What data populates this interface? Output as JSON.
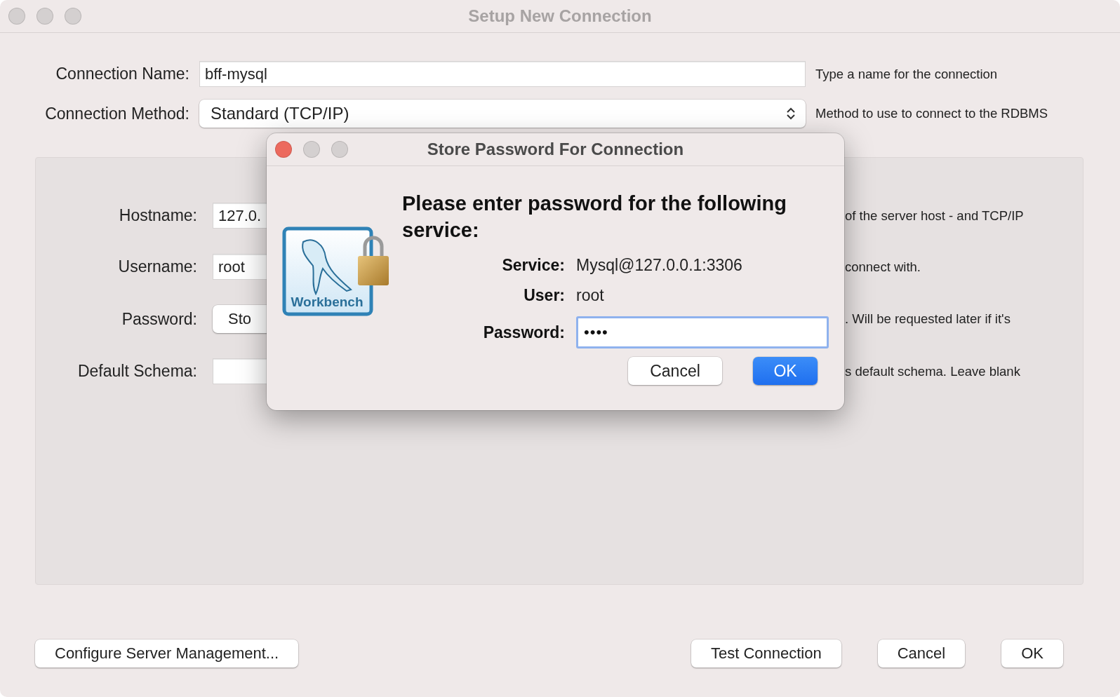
{
  "window": {
    "title": "Setup New Connection"
  },
  "form": [
    {
      "label": "Connection Name:",
      "kind": "text",
      "value": "bff-mysql",
      "help": "Type a name for the connection"
    },
    {
      "label": "Connection Method:",
      "kind": "select",
      "value": "Standard (TCP/IP)",
      "help": "Method to use to connect to the RDBMS"
    }
  ],
  "parameters": [
    {
      "label": "Hostname:",
      "kind": "text",
      "value": "127.0.",
      "help": "of the server host - and TCP/IP"
    },
    {
      "label": "Username:",
      "kind": "text",
      "value": "root",
      "help": "connect with."
    },
    {
      "label": "Password:",
      "kind": "button",
      "value": "Sto",
      "help": ". Will be requested later if it's"
    },
    {
      "label": "Default Schema:",
      "kind": "text",
      "help": "s default schema. Leave blank"
    }
  ],
  "buttons_left": [
    "Configure Server Management..."
  ],
  "buttons_right": [
    "Test Connection",
    "Cancel",
    "OK"
  ],
  "dialog": {
    "title": "Store Password For Connection",
    "logo_text": "Workbench",
    "heading": "Please enter password for the following service:",
    "fields": [
      {
        "label": "Service:",
        "kind": "text",
        "value": "Mysql@127.0.0.1:3306"
      },
      {
        "label": "User:",
        "kind": "text",
        "value": "root"
      },
      {
        "label": "Password:",
        "kind": "input",
        "value": "••••"
      }
    ],
    "buttons": [
      {
        "label": "Cancel",
        "default": false
      },
      {
        "label": "OK",
        "default": true
      }
    ]
  }
}
